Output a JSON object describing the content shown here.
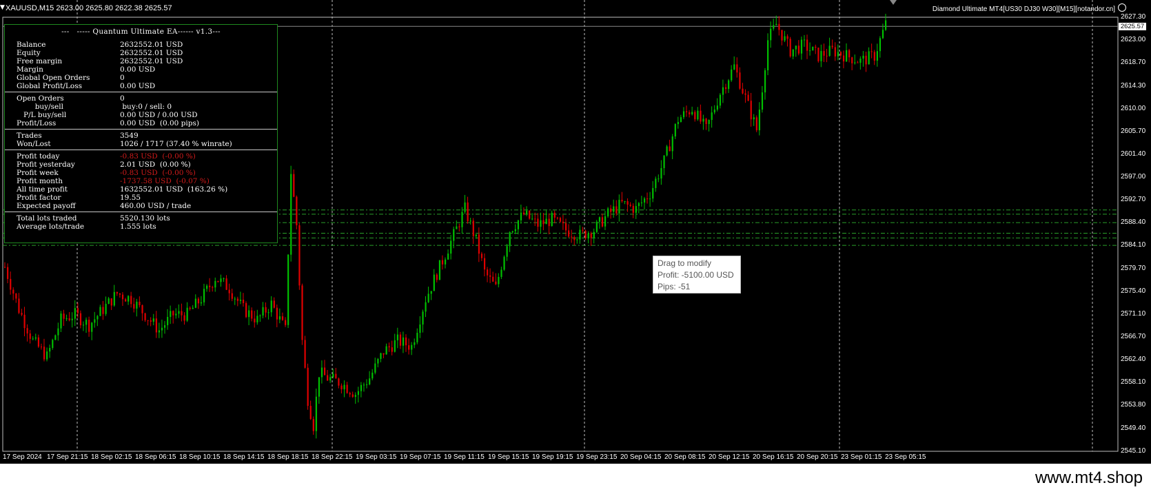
{
  "window": {
    "symbol": "XAUUSD,M15  2623.00 2625.80 2622.38 2625.57",
    "indicator_title": "Diamond Ultimate MT4[US30 DJ30 W30][M15][notandor.cn]",
    "watermark": "www.mt4.shop"
  },
  "ea_panel": {
    "title": "---   ----- Quantum Ultimate EA------ v1.3---",
    "account": [
      {
        "label": "Balance",
        "value": "2632552.01 USD"
      },
      {
        "label": "Equity",
        "value": "2632552.01 USD"
      },
      {
        "label": "Free margin",
        "value": "2632552.01 USD"
      },
      {
        "label": "Margin",
        "value": "0.00 USD"
      },
      {
        "label": "Global Open Orders",
        "value": "0"
      },
      {
        "label": "Global Profit/Loss",
        "value": "0.00 USD"
      }
    ],
    "orders": [
      {
        "label": "Open Orders",
        "value": "0"
      },
      {
        "label": "        buy/sell",
        "value": " buy:0 / sell: 0"
      },
      {
        "label": "   P/L buy/sell",
        "value": "0.00 USD / 0.00 USD"
      },
      {
        "label": "Profit/Loss",
        "value": "0.00 USD  (0.00 pips)"
      }
    ],
    "trades": [
      {
        "label": "Trades",
        "value": "3549"
      },
      {
        "label": "Won/Lost",
        "value": "1026 / 1717 (37.40 % winrate)"
      }
    ],
    "profits": [
      {
        "label": "Profit today",
        "value": "-0.83 USD  (-0.00 %)",
        "negative": true
      },
      {
        "label": "Profit yesterday",
        "value": "2.01 USD  (0.00 %)",
        "negative": false
      },
      {
        "label": "Profit week",
        "value": "-0.83 USD  (-0.00 %)",
        "negative": true
      },
      {
        "label": "Profit month",
        "value": "-1737.58 USD  (-0.07 %)",
        "negative": true
      },
      {
        "label": "All time profit",
        "value": "1632552.01 USD  (163.26 %)",
        "negative": false
      },
      {
        "label": "Profit factor",
        "value": "19.55",
        "negative": false
      },
      {
        "label": "Expected payoff",
        "value": "460.00 USD / trade",
        "negative": false
      }
    ],
    "lots": [
      {
        "label": "Total lots traded",
        "value": "5520.130 lots"
      },
      {
        "label": "Average lots/trade",
        "value": "1.555 lots"
      }
    ]
  },
  "tooltip": {
    "line1": "Drag to modify",
    "line2": "Profit: -5100.00 USD",
    "line3": "Pips: -51"
  },
  "price_axis": {
    "current_price": "2625.57",
    "ticks": [
      "2627.30",
      "2623.00",
      "2618.70",
      "2614.30",
      "2610.00",
      "2605.70",
      "2601.40",
      "2597.00",
      "2592.70",
      "2588.40",
      "2584.10",
      "2579.70",
      "2575.40",
      "2571.10",
      "2566.70",
      "2562.40",
      "2558.10",
      "2553.80",
      "2549.40",
      "2545.10"
    ]
  },
  "time_axis": {
    "ticks": [
      "17 Sep 2024",
      "17 Sep 21:15",
      "18 Sep 02:15",
      "18 Sep 06:15",
      "18 Sep 10:15",
      "18 Sep 14:15",
      "18 Sep 18:15",
      "18 Sep 22:15",
      "19 Sep 03:15",
      "19 Sep 07:15",
      "19 Sep 11:15",
      "19 Sep 15:15",
      "19 Sep 19:15",
      "19 Sep 23:15",
      "20 Sep 04:15",
      "20 Sep 08:15",
      "20 Sep 12:15",
      "20 Sep 16:15",
      "20 Sep 20:15",
      "23 Sep 01:15",
      "23 Sep 05:15"
    ]
  },
  "colors": {
    "bull": "#00c000",
    "bear": "#e00000",
    "grid": "#c0c0c0",
    "level_lines": "#2aa02a",
    "panel_border": "#1f8a1f"
  },
  "chart_data": {
    "type": "candlestick",
    "symbol": "XAUUSD",
    "timeframe": "M15",
    "ylim": [
      2545.1,
      2627.3
    ],
    "current_price": 2625.57,
    "close_path": [
      [
        0,
        2580
      ],
      [
        5,
        2572
      ],
      [
        10,
        2566
      ],
      [
        15,
        2563
      ],
      [
        20,
        2570
      ],
      [
        25,
        2571
      ],
      [
        30,
        2569
      ],
      [
        35,
        2572
      ],
      [
        40,
        2575
      ],
      [
        45,
        2574
      ],
      [
        50,
        2571
      ],
      [
        55,
        2568
      ],
      [
        60,
        2571
      ],
      [
        65,
        2571
      ],
      [
        70,
        2574
      ],
      [
        75,
        2578
      ],
      [
        80,
        2576
      ],
      [
        85,
        2572
      ],
      [
        90,
        2570
      ],
      [
        95,
        2573
      ],
      [
        100,
        2568
      ],
      [
        102,
        2598
      ],
      [
        104,
        2588
      ],
      [
        106,
        2566
      ],
      [
        108,
        2555
      ],
      [
        110,
        2550
      ],
      [
        112,
        2560
      ],
      [
        115,
        2559
      ],
      [
        120,
        2558
      ],
      [
        125,
        2556
      ],
      [
        130,
        2559
      ],
      [
        135,
        2564
      ],
      [
        140,
        2566
      ],
      [
        145,
        2565
      ],
      [
        150,
        2574
      ],
      [
        155,
        2580
      ],
      [
        160,
        2586
      ],
      [
        164,
        2591
      ],
      [
        168,
        2585
      ],
      [
        171,
        2579
      ],
      [
        175,
        2576
      ],
      [
        180,
        2587
      ],
      [
        185,
        2590
      ],
      [
        190,
        2588
      ],
      [
        195,
        2589
      ],
      [
        200,
        2587
      ],
      [
        205,
        2586
      ],
      [
        210,
        2587
      ],
      [
        215,
        2590
      ],
      [
        220,
        2592
      ],
      [
        225,
        2591
      ],
      [
        230,
        2594
      ],
      [
        235,
        2600
      ],
      [
        240,
        2608
      ],
      [
        245,
        2610
      ],
      [
        250,
        2606
      ],
      [
        255,
        2613
      ],
      [
        260,
        2618
      ],
      [
        264,
        2612
      ],
      [
        268,
        2606
      ],
      [
        270,
        2614
      ],
      [
        272,
        2623
      ],
      [
        275,
        2626
      ],
      [
        280,
        2621
      ],
      [
        285,
        2622
      ],
      [
        290,
        2620
      ],
      [
        295,
        2621
      ],
      [
        300,
        2620
      ],
      [
        305,
        2619
      ],
      [
        310,
        2620
      ],
      [
        314,
        2626
      ]
    ],
    "level_lines": [
      2590.8,
      2590.0,
      2588.4,
      2586.4,
      2585.5,
      2584.1
    ]
  }
}
